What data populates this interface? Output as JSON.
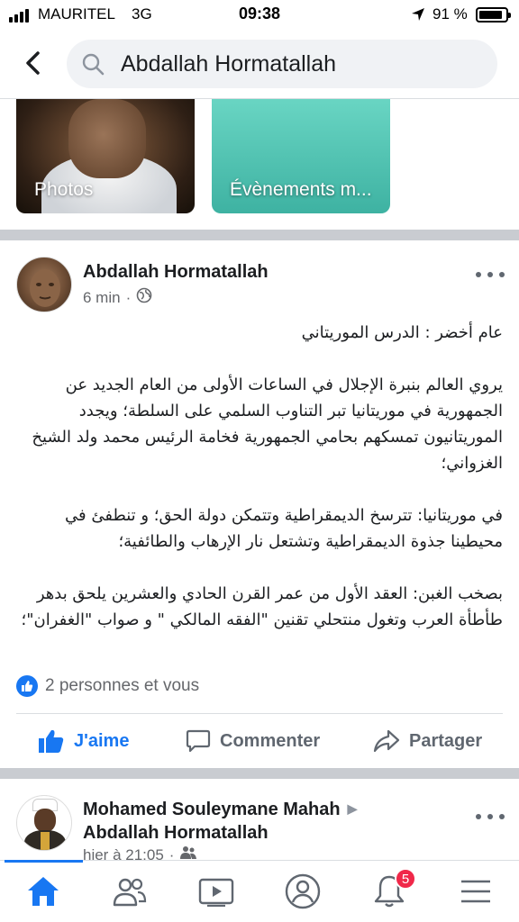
{
  "status_bar": {
    "carrier": "MAURITEL",
    "network": "3G",
    "time": "09:38",
    "battery_percent": "91 %",
    "battery_level": 0.91
  },
  "search": {
    "query": "Abdallah Hormatallah",
    "icon": "search-icon"
  },
  "shortcuts": [
    {
      "label": "Photos"
    },
    {
      "label": "Évènements m..."
    }
  ],
  "post": {
    "author": "Abdallah Hormatallah",
    "time": "6 min",
    "privacy_icon": "globe-icon",
    "paragraphs": [
      "عام أخضر : الدرس الموريتاني",
      "يروي العالم بنبرة الإجلال في الساعات الأولى من العام الجديد عن الجمهورية في موريتانيا تبر التناوب السلمي على السلطة؛ ويجدد الموريتانيون تمسكهم بحامي الجمهورية فخامة الرئيس محمد ولد الشيخ الغزواني؛",
      "في موريتانيا: تترسخ الديمقراطية وتتمكن دولة الحق؛ و تنطفئ في محيطينا جذوة الديمقراطية وتشتعل نار الإرهاب والطائفية؛",
      "بصخب الغبن: العقد الأول من عمر القرن الحادي والعشرين يلحق بدهر طأطأة العرب وتغول منتحلي تقنين \"الفقه المالكي \" و صواب \"الغفران\"؛"
    ],
    "reactions": "2 personnes et vous",
    "actions": {
      "like": "J'aime",
      "comment": "Commenter",
      "share": "Partager"
    }
  },
  "next_post": {
    "author": "Mohamed Souleymane Mahah",
    "target": "Abdallah Hormatallah",
    "time": "hier à 21:05",
    "audience_icon": "friends-icon"
  },
  "tabbar": {
    "items": [
      "home-icon",
      "friends-icon",
      "video-icon",
      "profile-icon",
      "bell-icon",
      "menu-icon"
    ],
    "notification_count": "5",
    "active": "home",
    "accent": "#1877f2"
  }
}
